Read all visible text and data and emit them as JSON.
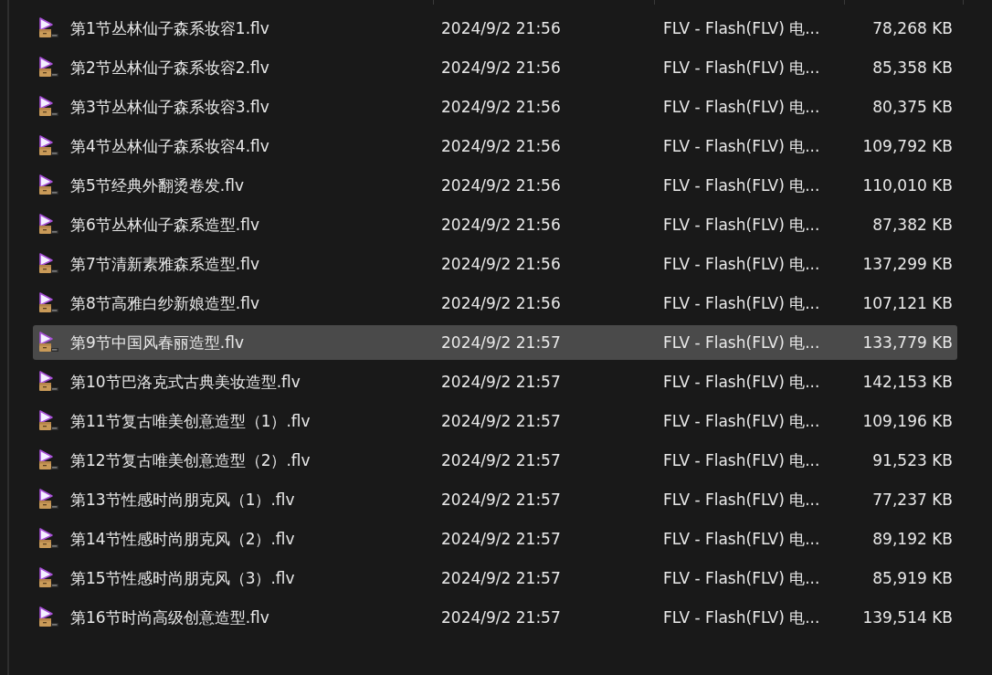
{
  "files": [
    {
      "name": "第1节丛林仙子森系妆容1.flv",
      "modified": "2024/9/2 21:56",
      "type": "FLV - Flash(FLV) 电...",
      "size": "78,268 KB",
      "selected": false
    },
    {
      "name": "第2节丛林仙子森系妆容2.flv",
      "modified": "2024/9/2 21:56",
      "type": "FLV - Flash(FLV) 电...",
      "size": "85,358 KB",
      "selected": false
    },
    {
      "name": "第3节丛林仙子森系妆容3.flv",
      "modified": "2024/9/2 21:56",
      "type": "FLV - Flash(FLV) 电...",
      "size": "80,375 KB",
      "selected": false
    },
    {
      "name": "第4节丛林仙子森系妆容4.flv",
      "modified": "2024/9/2 21:56",
      "type": "FLV - Flash(FLV) 电...",
      "size": "109,792 KB",
      "selected": false
    },
    {
      "name": "第5节经典外翻烫卷发.flv",
      "modified": "2024/9/2 21:56",
      "type": "FLV - Flash(FLV) 电...",
      "size": "110,010 KB",
      "selected": false
    },
    {
      "name": "第6节丛林仙子森系造型.flv",
      "modified": "2024/9/2 21:56",
      "type": "FLV - Flash(FLV) 电...",
      "size": "87,382 KB",
      "selected": false
    },
    {
      "name": "第7节清新素雅森系造型.flv",
      "modified": "2024/9/2 21:56",
      "type": "FLV - Flash(FLV) 电...",
      "size": "137,299 KB",
      "selected": false
    },
    {
      "name": "第8节高雅白纱新娘造型.flv",
      "modified": "2024/9/2 21:56",
      "type": "FLV - Flash(FLV) 电...",
      "size": "107,121 KB",
      "selected": false
    },
    {
      "name": "第9节中国风春丽造型.flv",
      "modified": "2024/9/2 21:57",
      "type": "FLV - Flash(FLV) 电...",
      "size": "133,779 KB",
      "selected": true
    },
    {
      "name": "第10节巴洛克式古典美妆造型.flv",
      "modified": "2024/9/2 21:57",
      "type": "FLV - Flash(FLV) 电...",
      "size": "142,153 KB",
      "selected": false
    },
    {
      "name": "第11节复古唯美创意造型（1）.flv",
      "modified": "2024/9/2 21:57",
      "type": "FLV - Flash(FLV) 电...",
      "size": "109,196 KB",
      "selected": false
    },
    {
      "name": "第12节复古唯美创意造型（2）.flv",
      "modified": "2024/9/2 21:57",
      "type": "FLV - Flash(FLV) 电...",
      "size": "91,523 KB",
      "selected": false
    },
    {
      "name": "第13节性感时尚朋克风（1）.flv",
      "modified": "2024/9/2 21:57",
      "type": "FLV - Flash(FLV) 电...",
      "size": "77,237 KB",
      "selected": false
    },
    {
      "name": "第14节性感时尚朋克风（2）.flv",
      "modified": "2024/9/2 21:57",
      "type": "FLV - Flash(FLV) 电...",
      "size": "89,192 KB",
      "selected": false
    },
    {
      "name": "第15节性感时尚朋克风（3）.flv",
      "modified": "2024/9/2 21:57",
      "type": "FLV - Flash(FLV) 电...",
      "size": "85,919 KB",
      "selected": false
    },
    {
      "name": "第16节时尚高级创意造型.flv",
      "modified": "2024/9/2 21:57",
      "type": "FLV - Flash(FLV) 电...",
      "size": "139,514 KB",
      "selected": false
    }
  ]
}
